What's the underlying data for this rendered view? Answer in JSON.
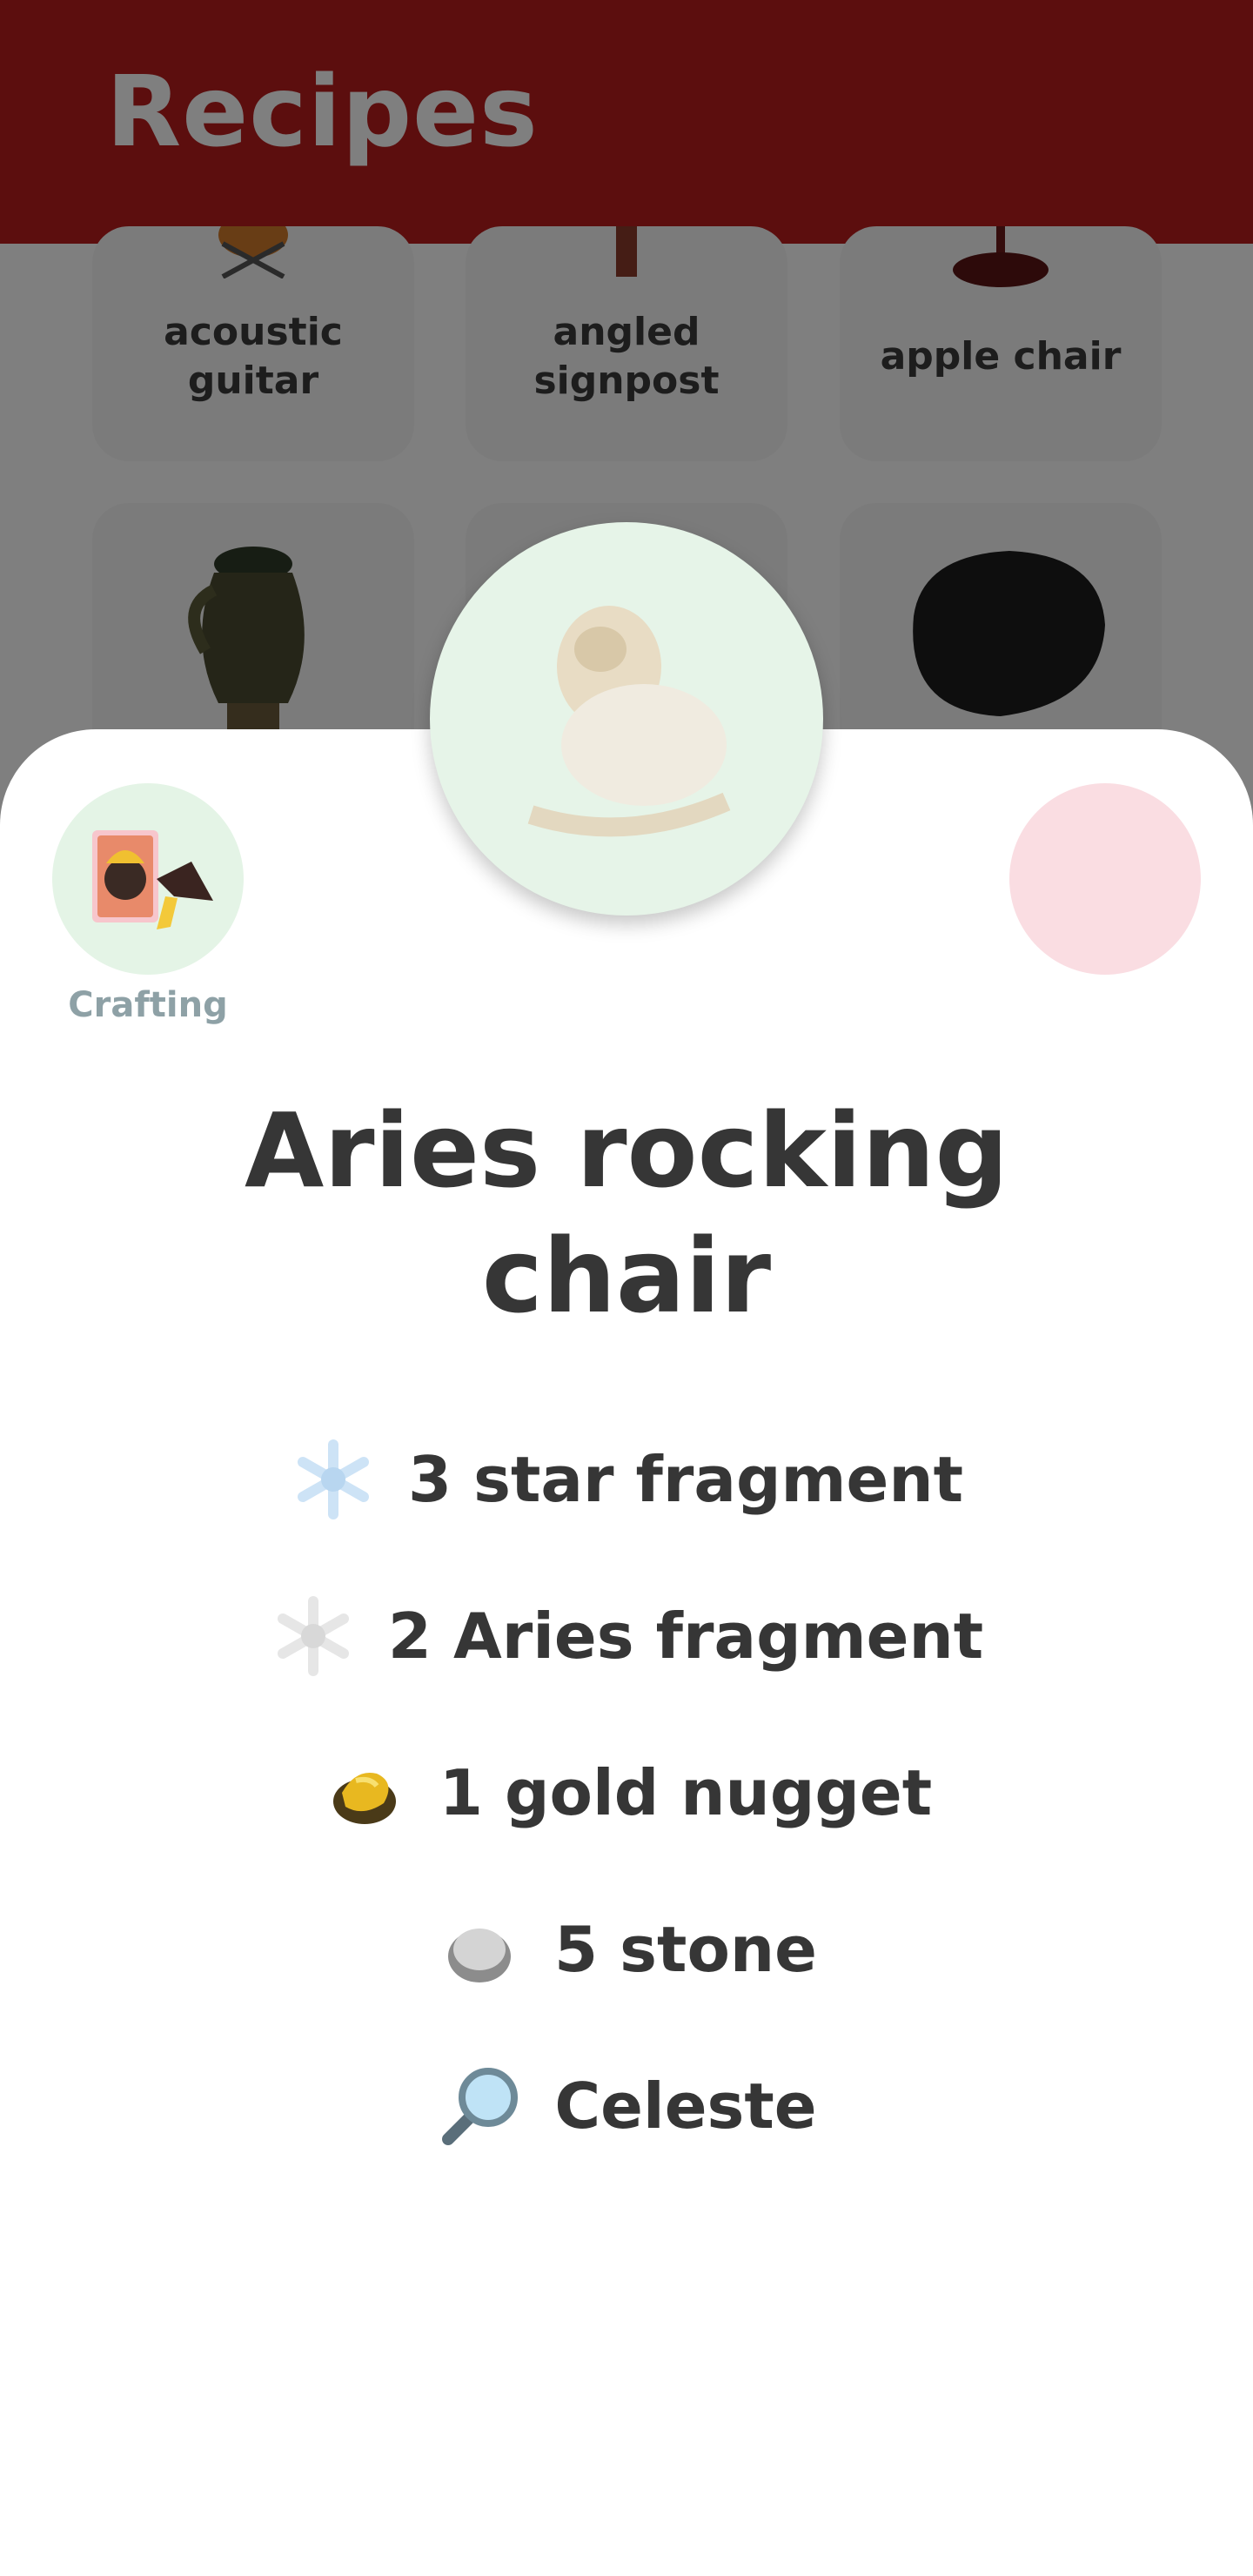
{
  "appbar": {
    "title": "Recipes",
    "color": "#b81d1d"
  },
  "grid": {
    "tiles": [
      {
        "label": "acoustic guitar",
        "icon": "acoustic-guitar-icon"
      },
      {
        "label": "angled signpost",
        "icon": "angled-signpost-icon"
      },
      {
        "label": "apple chair",
        "icon": "apple-chair-icon"
      },
      {
        "label": "",
        "icon": "vase-icon"
      },
      {
        "label": "",
        "icon": "item-icon"
      },
      {
        "label": "",
        "icon": "rock-icon"
      }
    ]
  },
  "detail": {
    "source": {
      "label": "Crafting",
      "icon": "crafting-recipe-icon"
    },
    "title": "Aries rocking chair",
    "ingredients": [
      {
        "text": "3 star fragment",
        "icon": "star-fragment-icon"
      },
      {
        "text": "2 Aries fragment",
        "icon": "aries-fragment-icon"
      },
      {
        "text": "1 gold nugget",
        "icon": "gold-nugget-icon"
      },
      {
        "text": "5 stone",
        "icon": "stone-icon"
      },
      {
        "text": "Celeste",
        "icon": "magnifier-icon"
      }
    ]
  }
}
